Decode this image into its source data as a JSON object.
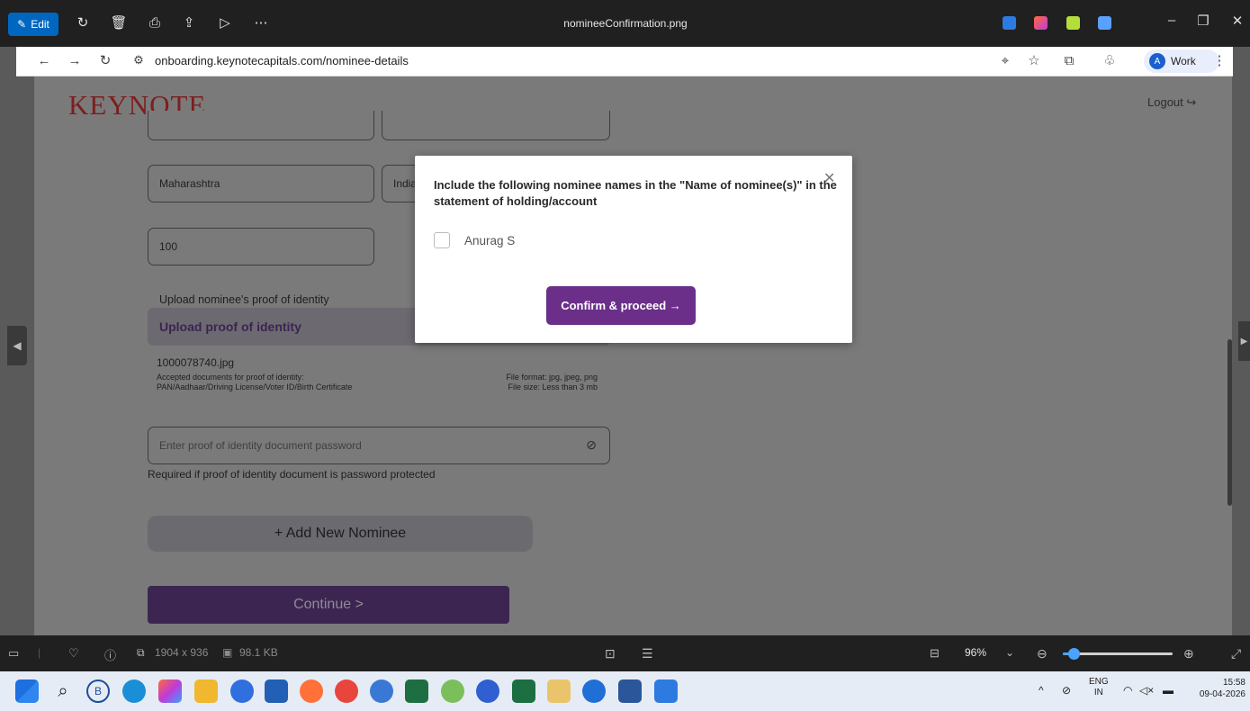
{
  "viewer": {
    "edit_label": "Edit",
    "file_title": "nomineeConfirmation.png",
    "top_icons": [
      "rotate-icon",
      "delete-icon",
      "print-icon",
      "share-icon",
      "slideshow-icon",
      "more-icon"
    ]
  },
  "browser": {
    "url": "onboarding.keynotecapitals.com/nominee-details",
    "profile_initial": "A",
    "profile_label": "Work"
  },
  "page": {
    "brand": "KEYNOTE",
    "logout_label": "Logout",
    "state_value": "Maharashtra",
    "country_value": "India",
    "share_value": "100",
    "upload_label": "Upload nominee's proof of identity",
    "upload_button": "Upload proof of identity",
    "uploaded_file": "1000078740.jpg",
    "accepted_docs_title": "Accepted documents for proof of identity:",
    "accepted_docs_list": "PAN/Aadhaar/Driving License/Voter ID/Birth Certificate",
    "file_format": "File format: jpg, jpeg, png",
    "file_size": "File size: Less than 3 mb",
    "password_placeholder": "Enter proof of identity document password",
    "password_hint": "Required if proof of identity document is password protected",
    "add_nominee": "+ Add New Nominee",
    "continue": "Continue >"
  },
  "modal": {
    "message": "Include the following nominee names in the \"Name of nominee(s)\" in the statement of holding/account",
    "nominee_name": "Anurag S",
    "nominee_checked": false,
    "confirm": "Confirm & proceed →"
  },
  "bottom_bar": {
    "dimensions": "1904 x 936",
    "file_size": "98.1 KB",
    "zoom": "96%",
    "zoom_level": 0.1
  },
  "taskbar": {
    "lang_top": "ENG",
    "lang_bottom": "IN",
    "time": "15:58",
    "date": "09-04-2026"
  },
  "colors": {
    "brand_red": "#7d1e1e",
    "primary_purple": "#6b2f89",
    "edit_blue": "#0067c0"
  }
}
